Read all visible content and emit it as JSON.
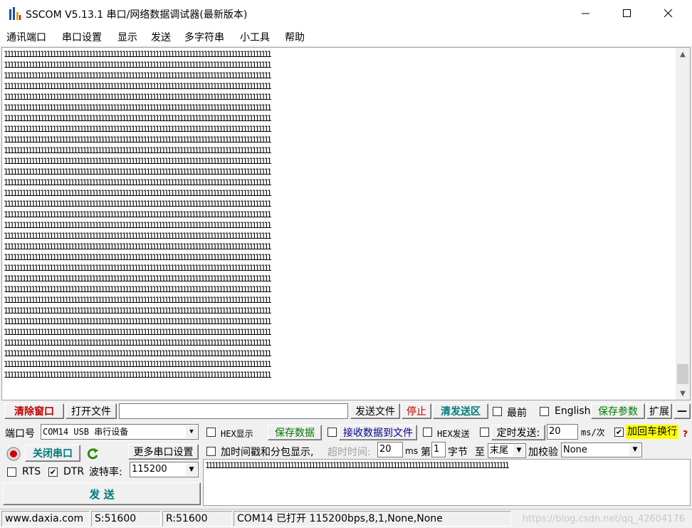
{
  "window": {
    "title": "SSCOM V5.13.1 串口/网络数据调试器(最新版本)",
    "minimize_glyph": "—",
    "maximize_glyph": "☐",
    "close_glyph": "✕"
  },
  "menu": {
    "items": [
      "通讯端口",
      "串口设置",
      "显示",
      "发送",
      "多字符串",
      "小工具",
      "帮助"
    ]
  },
  "receive": {
    "line": "1111111111111111111111111111111111111111111111111111111111111111111111111111111111111111",
    "line_count": 31
  },
  "row1": {
    "clear_window": "清除窗口",
    "open_file": "打开文件",
    "file_path": "",
    "send_file": "发送文件",
    "stop": "停止",
    "clear_send": "清发送区",
    "topmost": "最前",
    "english": "English",
    "save_params": "保存参数",
    "expand": "扩展",
    "collapse": "—"
  },
  "row2": {
    "port_label": "端口号",
    "port_value": "COM14 USB 串行设备",
    "hex_display": "HEX显示",
    "save_data": "保存数据",
    "recv_to_file": "接收数据到文件",
    "hex_send": "HEX发送",
    "timed_send": "定时发送:",
    "interval": "20",
    "interval_unit": "ms/次",
    "add_crlf": "加回车换行"
  },
  "row3": {
    "close_port": "关闭串口",
    "more_settings": "更多串口设置",
    "add_timestamp": "加时间戳和分包显示,",
    "timeout_label": "超时时间:",
    "timeout_value": "20",
    "timeout_unit": "ms",
    "nth_label": "第",
    "nth_value": "1",
    "byte_label": "字节",
    "to_label": "至",
    "end_value": "末尾",
    "checksum_label": "加校验",
    "checksum_value": "None"
  },
  "row4": {
    "rts": "RTS",
    "dtr": "DTR",
    "dtr_checked": true,
    "rts_checked": false,
    "baud_label": "波特率:",
    "baud_value": "115200"
  },
  "send": {
    "button": "发 送",
    "text": "1111111111111111111111111111111111111111111111111111111111111111111111111111111111111111111111111111"
  },
  "status": {
    "site": "www.daxia.com",
    "sent": "S:51600",
    "received": "R:51600",
    "port_state": "COM14 已打开  115200bps,8,1,None,None",
    "watermark": "https://blog.csdn.net/qq_42604176"
  },
  "colors": {
    "accent_red": "#c00000",
    "accent_green": "#007a00",
    "accent_teal": "#007a7a",
    "highlight_yellow": "#ffff00"
  }
}
